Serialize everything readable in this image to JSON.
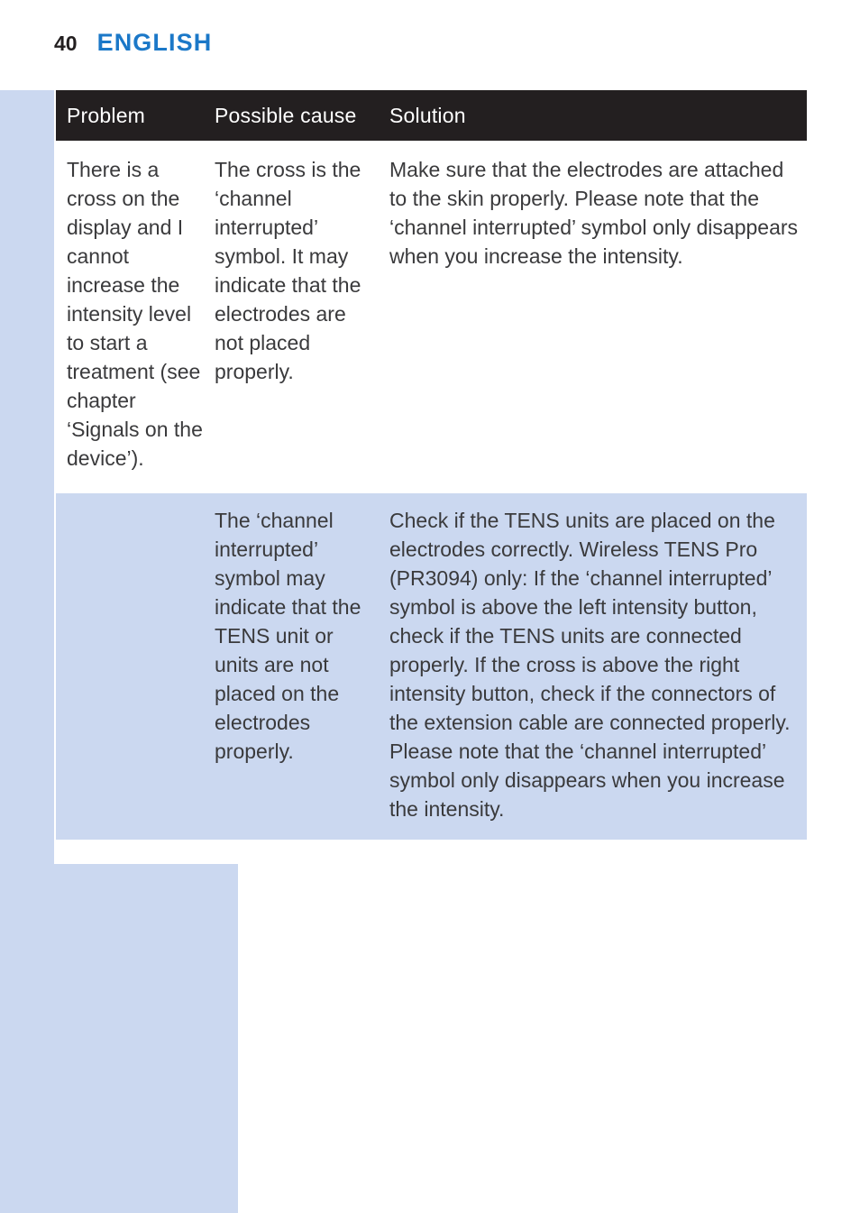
{
  "page": {
    "number": "40",
    "title": "ENGLISH",
    "title_color": "#1b78c8",
    "shade_color": "#cbd8f0",
    "header_bar_color": "#231f20"
  },
  "table": {
    "headers": {
      "problem": "Problem",
      "cause": "Possible cause",
      "solution": "Solution"
    },
    "rows": [
      {
        "problem": "There is a cross on the display and I cannot increase the intensity level to start a treatment (see chapter ‘Signals on the device’).",
        "cause": "The cross is the ‘channel interrupted’ symbol. It may indicate that the electrodes are not placed properly.",
        "solution": "Make sure that the electrodes are attached to the skin properly. Please note that the ‘channel interrupted’ symbol only disappears when you increase the intensity."
      },
      {
        "problem": "",
        "cause": "The ‘channel interrupted’ symbol may indicate that the TENS unit or units are not placed on the electrodes properly.",
        "solution": "Check if the TENS units are placed on the electrodes correctly. Wireless TENS Pro (PR3094) only: If the ‘channel interrupted’ symbol is above the left intensity button, check if the TENS units are connected properly. If the cross is above the right intensity button, check if the connectors of the extension cable are connected properly. Please note that the ‘channel interrupted’ symbol only disappears when you increase the intensity."
      }
    ]
  }
}
